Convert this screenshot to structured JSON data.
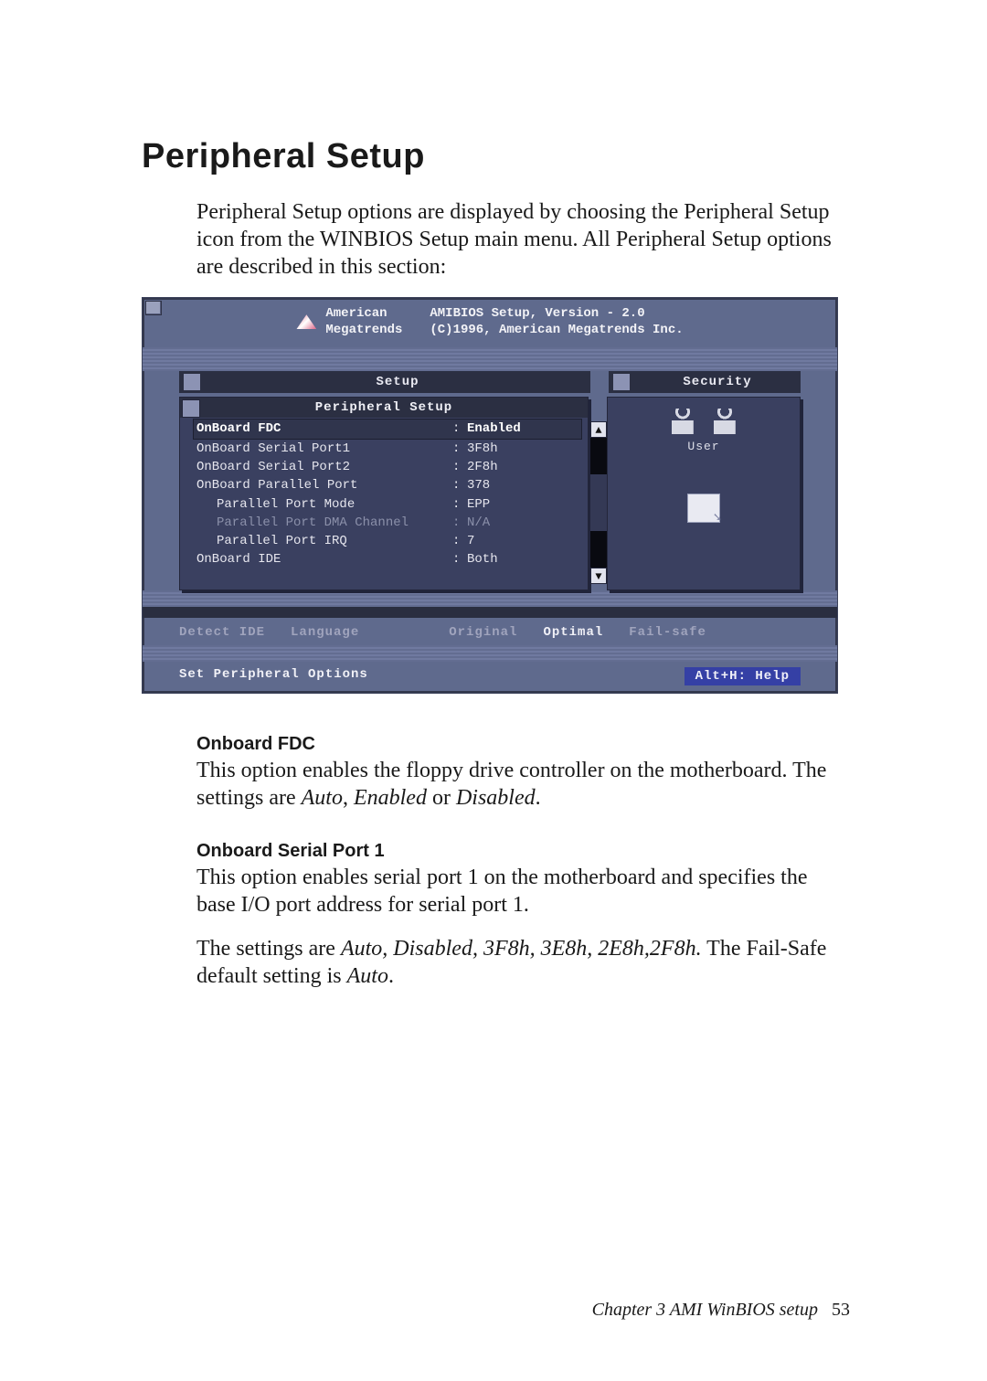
{
  "page": {
    "title": "Peripheral  Setup",
    "intro": "Peripheral Setup options are displayed by choosing the Peripheral Setup icon from the WINBIOS Setup main menu.  All Peripheral Setup options are described in this section:",
    "footer_chapter": "Chapter 3  AMI WinBIOS  setup",
    "footer_page": "53"
  },
  "bios": {
    "brand_line1": "American",
    "brand_line2": "Megatrends",
    "title_line1": "AMIBIOS Setup, Version - 2.0",
    "title_line2": "(C)1996, American Megatrends Inc.",
    "window_setup": "Setup",
    "window_security": "Security",
    "pane_title": "Peripheral Setup",
    "side_label_user": "User",
    "rows": [
      {
        "label": "OnBoard FDC",
        "value": "Enabled",
        "sel": true,
        "dim": false,
        "indent": false
      },
      {
        "label": "OnBoard Serial Port1",
        "value": "3F8h",
        "sel": false,
        "dim": false,
        "indent": false
      },
      {
        "label": "OnBoard Serial Port2",
        "value": "2F8h",
        "sel": false,
        "dim": false,
        "indent": false
      },
      {
        "label": "OnBoard Parallel Port",
        "value": "378",
        "sel": false,
        "dim": false,
        "indent": false
      },
      {
        "label": "Parallel Port Mode",
        "value": "EPP",
        "sel": false,
        "dim": false,
        "indent": true
      },
      {
        "label": "Parallel Port DMA Channel",
        "value": "N/A",
        "sel": false,
        "dim": true,
        "indent": true
      },
      {
        "label": "Parallel Port IRQ",
        "value": "7",
        "sel": false,
        "dim": false,
        "indent": true
      },
      {
        "label": "OnBoard IDE",
        "value": "Both",
        "sel": false,
        "dim": false,
        "indent": false
      }
    ],
    "buttons": {
      "detect_ide": "Detect IDE",
      "language": "Language",
      "original": "Original",
      "optimal": "Optimal",
      "failsafe": "Fail-safe"
    },
    "status_left": "Set Peripheral Options",
    "status_right": "Alt+H: Help"
  },
  "sections": {
    "s1_head": "Onboard FDC",
    "s1_p1a": "This option enables the floppy drive controller on the motherboard. The settings are ",
    "s1_p1_i1": "Auto",
    "s1_p1b": ", ",
    "s1_p1_i2": "Enabled",
    "s1_p1c": " or ",
    "s1_p1_i3": "Disabled",
    "s1_p1d": ".",
    "s2_head": "Onboard Serial Port 1",
    "s2_p1": "This option enables serial port 1 on the motherboard and specifies the base I/O port address for serial port 1.",
    "s2_p2a": "The settings are ",
    "s2_p2_i1": "Auto, Disabled, 3F8h, 3E8h, 2E8h,2F8h.",
    "s2_p2b": " The Fail-Safe default setting is ",
    "s2_p2_i2": "Auto",
    "s2_p2c": "."
  }
}
